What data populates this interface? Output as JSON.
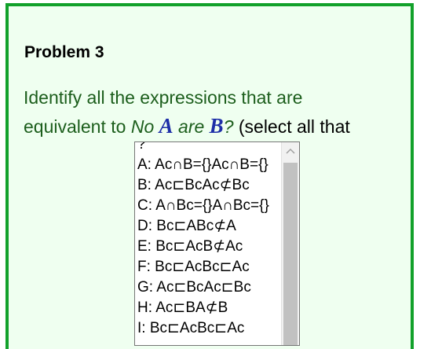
{
  "problem": {
    "title": "Problem 3",
    "question_prefix": "Identify all the expressions that are equivalent to ",
    "no_word": "No",
    "set_a": "A",
    "are_word": "are",
    "set_b": "B",
    "question_mark": "?",
    "question_suffix": " (select all that"
  },
  "listbox": {
    "partial_top": "?",
    "options": [
      "A: Ac∩B={}Ac∩B={}",
      "B: Ac⊏BcAc⊄Bc",
      "C: A∩Bc={}A∩Bc={}",
      "D: Bc⊏ABc⊄A",
      "E: Bc⊏AcB⊄Ac",
      "F: Bc⊏AcBc⊏Ac",
      "G: Ac⊏BcAc⊏Bc",
      "H: Ac⊏BA⊄B",
      "I: Bc⊏AcBc⊏Ac"
    ]
  },
  "colors": {
    "border": "#12a12b",
    "panel_bg": "#effff0",
    "question_text": "#1c5e1c",
    "set_letters": "#1e2fa8"
  },
  "icons": {
    "scroll_up": "chevron-up-icon"
  }
}
